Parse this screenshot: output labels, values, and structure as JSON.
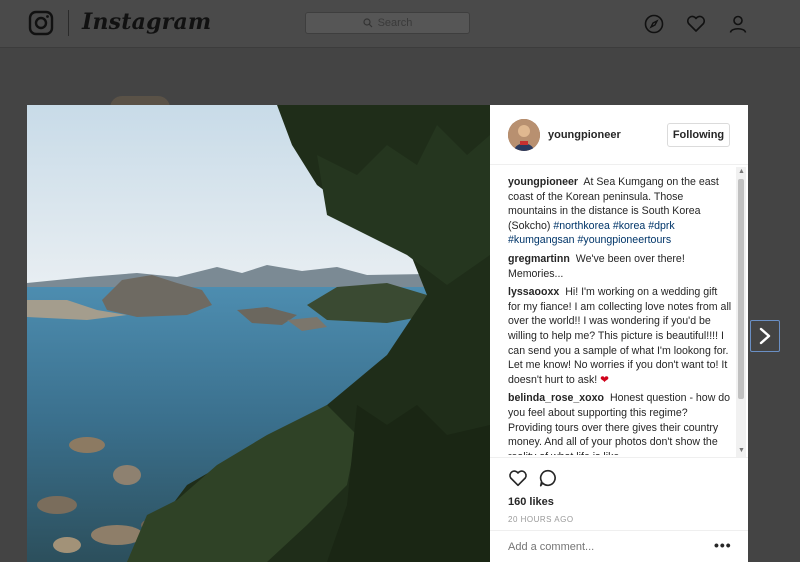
{
  "header": {
    "wordmark": "Instagram",
    "search_placeholder": "Search",
    "icons": [
      "instagram-logo-icon",
      "compass-icon",
      "heart-icon",
      "person-icon"
    ]
  },
  "post": {
    "username": "youngpioneer",
    "follow_label": "Following",
    "comments": [
      {
        "user": "youngpioneer",
        "text": "At Sea Kumgang on the east coast of the Korean peninsula. Those mountains in the distance is South Korea (Sokcho)",
        "tags": [
          "#northkorea",
          "#korea",
          "#dprk",
          "#kumgangsan",
          "#youngpioneertours"
        ]
      },
      {
        "user": "gregmartinn",
        "text": "We've been over there! Memories...",
        "tags": []
      },
      {
        "user": "lyssaooxx",
        "text": "Hi! I'm working on a wedding gift for my fiance! I am collecting love notes from all over the world!! I was wondering if you'd be willing to help me? This picture is beautiful!!!! I can send you a sample of what I'm lookong for. Let me know! No worries if you don't want to! It doesn't hurt to ask!",
        "emoji": "❤",
        "tags": []
      },
      {
        "user": "belinda_rose_xoxo",
        "text": "Honest question - how do you feel about supporting this regime? Providing tours over there gives their country money. And all of your photos don't show the reality of what life is like",
        "tags": []
      }
    ],
    "likes": "160 likes",
    "timestamp": "20 HOURS AGO",
    "add_comment_placeholder": "Add a comment...",
    "more_label": "•••"
  },
  "colors": {
    "hashtag": "#003569",
    "heart": "#d0021b",
    "overlay": "#444444"
  }
}
